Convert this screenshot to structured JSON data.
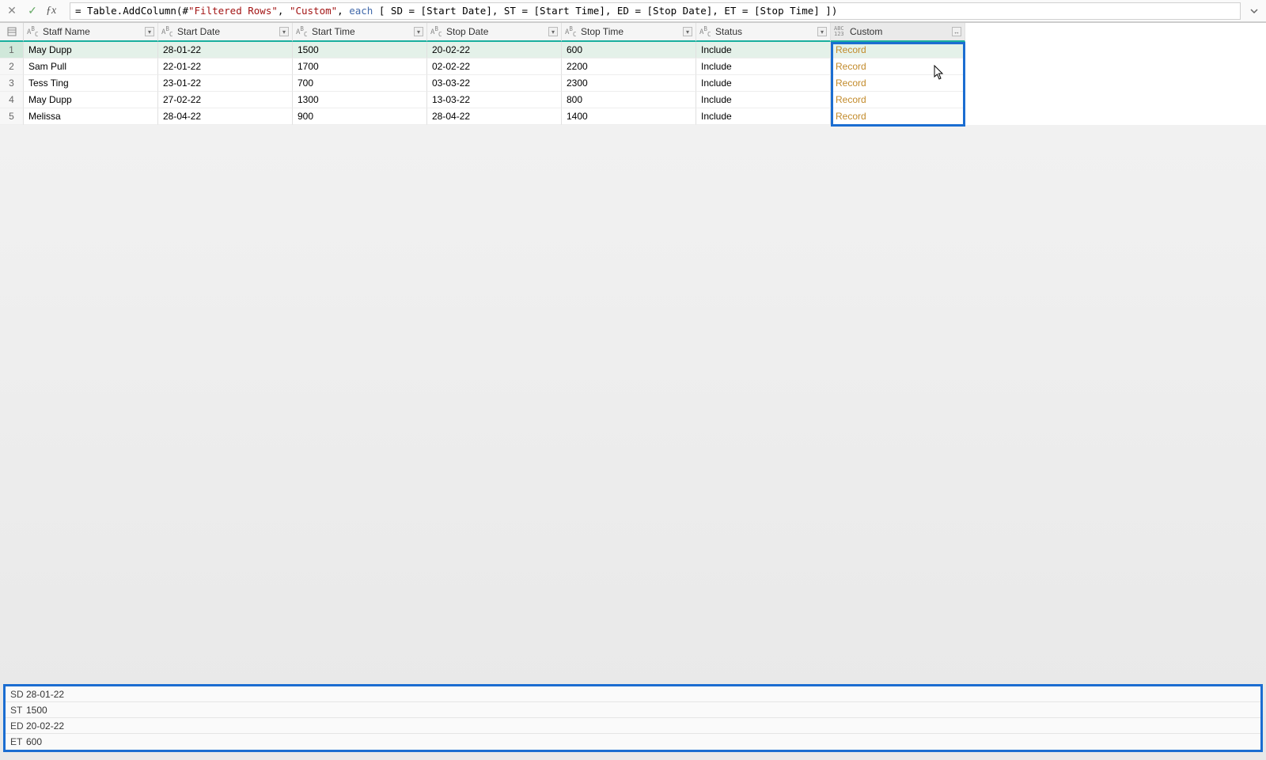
{
  "formula": {
    "prefix": "= Table.AddColumn(#",
    "arg1": "\"Filtered Rows\"",
    "sep1": ", ",
    "arg2": "\"Custom\"",
    "sep2": ", ",
    "each_kw": "each",
    "body": " [ SD = [Start Date], ST = [Start Time], ED = [Stop Date], ET = [Stop Time] ])"
  },
  "type_labels": {
    "text": "Aᵇᴄ",
    "any": "ABC\n123"
  },
  "columns": [
    {
      "key": "name",
      "label": "Staff Name",
      "type": "text"
    },
    {
      "key": "start",
      "label": "Start Date",
      "type": "text"
    },
    {
      "key": "stime",
      "label": "Start Time",
      "type": "text"
    },
    {
      "key": "stop",
      "label": "Stop Date",
      "type": "text"
    },
    {
      "key": "etime",
      "label": "Stop Time",
      "type": "text"
    },
    {
      "key": "status",
      "label": "Status",
      "type": "text"
    },
    {
      "key": "custom",
      "label": "Custom",
      "type": "any"
    }
  ],
  "rows": [
    {
      "n": "1",
      "name": "May Dupp",
      "start": "28-01-22",
      "stime": "1500",
      "stop": "20-02-22",
      "etime": "600",
      "status": "Include",
      "custom": "Record"
    },
    {
      "n": "2",
      "name": "Sam Pull",
      "start": "22-01-22",
      "stime": "1700",
      "stop": "02-02-22",
      "etime": "2200",
      "status": "Include",
      "custom": "Record"
    },
    {
      "n": "3",
      "name": "Tess Ting",
      "start": "23-01-22",
      "stime": "700",
      "stop": "03-03-22",
      "etime": "2300",
      "status": "Include",
      "custom": "Record"
    },
    {
      "n": "4",
      "name": "May Dupp",
      "start": "27-02-22",
      "stime": "1300",
      "stop": "13-03-22",
      "etime": "800",
      "status": "Include",
      "custom": "Record"
    },
    {
      "n": "5",
      "name": "Melissa",
      "start": "28-04-22",
      "stime": "900",
      "stop": "28-04-22",
      "etime": "1400",
      "status": "Include",
      "custom": "Record"
    }
  ],
  "record_preview": [
    {
      "k": "SD",
      "v": "28-01-22"
    },
    {
      "k": "ST",
      "v": "1500"
    },
    {
      "k": "ED",
      "v": "20-02-22"
    },
    {
      "k": "ET",
      "v": "600"
    }
  ]
}
